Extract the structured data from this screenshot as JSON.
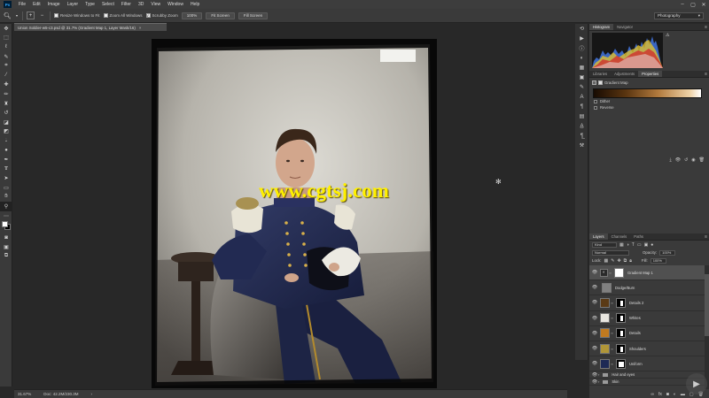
{
  "menubar": {
    "logo": "Ps",
    "items": [
      "File",
      "Edit",
      "Image",
      "Layer",
      "Type",
      "Select",
      "Filter",
      "3D",
      "View",
      "Window",
      "Help"
    ],
    "controls": [
      "–",
      "▢",
      "✕"
    ]
  },
  "options": {
    "resize_windows": "Resize Windows to Fit",
    "zoom_all": "Zoom All Windows",
    "scrubby_zoom": "Scrubby Zoom",
    "zoom_level": "100%",
    "fit_screen": "Fit Screen",
    "fill_screen": "Fill Screen",
    "workspace": "Photography"
  },
  "document": {
    "tab_title": "Union Soldier-w5-c3.psd @ 31.7% (Gradient Map 1, Layer Mask/16)",
    "close": "×",
    "status_zoom": "31.67%",
    "status_doc": "Doc: 42.2M/230.3M",
    "status_arrow": "›"
  },
  "watermark": "www.cgtsj.com",
  "panels": {
    "top_tabs": [
      "Histogram",
      "Navigator"
    ],
    "mid_tabs": [
      "Libraries",
      "Adjustments",
      "Properties"
    ],
    "props_title": "Gradient Map",
    "dither": "Dither",
    "reverse": "Reverse",
    "layers_tabs": [
      "Layers",
      "Channels",
      "Paths"
    ],
    "kind": "Kind",
    "blend_mode": "Normal",
    "opacity_label": "Opacity:",
    "opacity_value": "100%",
    "lock_label": "Lock:",
    "fill_label": "Fill:",
    "fill_value": "100%"
  },
  "layers": [
    {
      "name": "Gradient Map 1",
      "type": "adjustment",
      "selected": true
    },
    {
      "name": "Dodge/Burn",
      "type": "plain"
    },
    {
      "name": "Details 2",
      "type": "color",
      "color": "#5a3a16"
    },
    {
      "name": "Whites",
      "type": "color",
      "color": "#e8e6e0"
    },
    {
      "name": "Details",
      "type": "color",
      "color": "#c07a20"
    },
    {
      "name": "Shoulders",
      "type": "color",
      "color": "#b09638"
    },
    {
      "name": "Uniform",
      "type": "color",
      "color": "#1e2a55"
    },
    {
      "name": "Hair and eyes",
      "type": "group"
    },
    {
      "name": "Skin",
      "type": "group"
    }
  ]
}
